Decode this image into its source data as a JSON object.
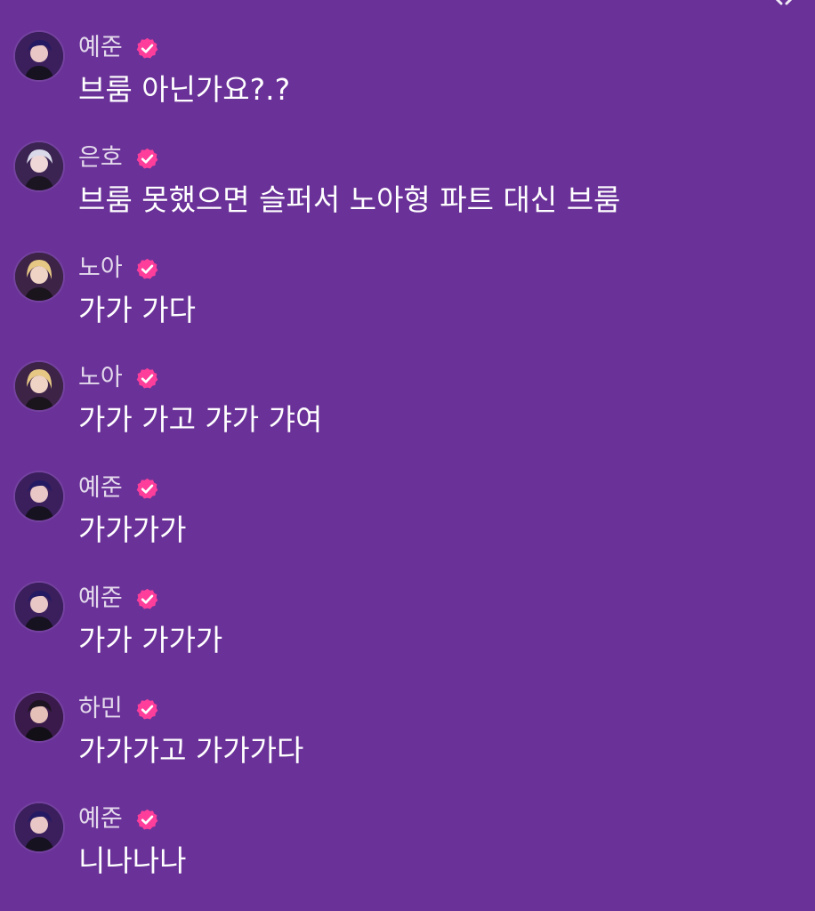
{
  "chat": {
    "messages": [
      {
        "username": "예준",
        "text": "브룸 아닌가요?.?",
        "avatar": "yejun-avatar",
        "verified": true
      },
      {
        "username": "은호",
        "text": "브룸 못했으면 슬퍼서 노아형 파트 대신 브룸",
        "avatar": "eunho-avatar",
        "verified": true
      },
      {
        "username": "노아",
        "text": "가가 가다",
        "avatar": "noah-avatar",
        "verified": true
      },
      {
        "username": "노아",
        "text": "가가 가고 갸가 갸여",
        "avatar": "noah-avatar",
        "verified": true
      },
      {
        "username": "예준",
        "text": "가가가가",
        "avatar": "yejun-avatar",
        "verified": true
      },
      {
        "username": "예준",
        "text": "가가 가가가",
        "avatar": "yejun-avatar",
        "verified": true
      },
      {
        "username": "하민",
        "text": "가가가고 가가가다",
        "avatar": "hamin-avatar",
        "verified": true
      },
      {
        "username": "예준",
        "text": "니나나나",
        "avatar": "yejun-avatar",
        "verified": true
      }
    ]
  },
  "colors": {
    "background": "#6a3298",
    "verified_badge": "#ff3d9a",
    "text": "#ffffff"
  }
}
